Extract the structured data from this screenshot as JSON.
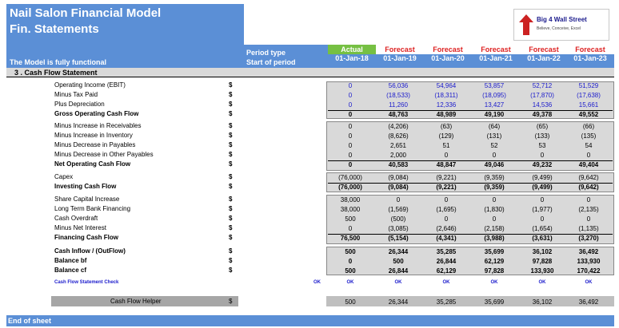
{
  "header": {
    "title": "Nail Salon Financial Model",
    "subtitle": "Fin. Statements",
    "note": "The Model is fully functional",
    "period_type_label": "Period type",
    "start_of_period_label": "Start of period",
    "logo": {
      "name": "Big 4 Wall Street",
      "tagline": "Believe, Conceive, Excel"
    }
  },
  "columns": [
    {
      "type": "Actual",
      "date": "01-Jan-18"
    },
    {
      "type": "Forecast",
      "date": "01-Jan-19"
    },
    {
      "type": "Forecast",
      "date": "01-Jan-20"
    },
    {
      "type": "Forecast",
      "date": "01-Jan-21"
    },
    {
      "type": "Forecast",
      "date": "01-Jan-22"
    },
    {
      "type": "Forecast",
      "date": "01-Jan-23"
    }
  ],
  "section_title": "3 .  Cash Flow Statement",
  "currency": "$",
  "rows": [
    {
      "label": "Operating Income (EBIT)",
      "values": [
        "0",
        "56,036",
        "54,964",
        "53,857",
        "52,712",
        "51,529"
      ]
    },
    {
      "label": "Minus Tax Paid",
      "values": [
        "0",
        "(18,533)",
        "(18,311)",
        "(18,095)",
        "(17,870)",
        "(17,638)"
      ]
    },
    {
      "label": "Plus Depreciation",
      "values": [
        "0",
        "11,260",
        "12,336",
        "13,427",
        "14,536",
        "15,661"
      ]
    },
    {
      "label": "Gross Operating Cash Flow",
      "values": [
        "0",
        "48,763",
        "48,989",
        "49,190",
        "49,378",
        "49,552"
      ]
    },
    {
      "label": "Minus Increase in Receivables",
      "values": [
        "0",
        "(4,206)",
        "(63)",
        "(64)",
        "(65)",
        "(66)"
      ]
    },
    {
      "label": "Minus Increase in Inventory",
      "values": [
        "0",
        "(8,626)",
        "(129)",
        "(131)",
        "(133)",
        "(135)"
      ]
    },
    {
      "label": "Minus Decrease in Payables",
      "values": [
        "0",
        "2,651",
        "51",
        "52",
        "53",
        "54"
      ]
    },
    {
      "label": "Minus Decrease in Other Payables",
      "values": [
        "0",
        "2,000",
        "0",
        "0",
        "0",
        "0"
      ]
    },
    {
      "label": "Net Operating Cash Flow",
      "values": [
        "0",
        "40,583",
        "48,847",
        "49,046",
        "49,232",
        "49,404"
      ]
    },
    {
      "label": "Capex",
      "values": [
        "(76,000)",
        "(9,084)",
        "(9,221)",
        "(9,359)",
        "(9,499)",
        "(9,642)"
      ]
    },
    {
      "label": "Investing Cash Flow",
      "values": [
        "(76,000)",
        "(9,084)",
        "(9,221)",
        "(9,359)",
        "(9,499)",
        "(9,642)"
      ]
    },
    {
      "label": "Share Capital Increase",
      "values": [
        "38,000",
        "0",
        "0",
        "0",
        "0",
        "0"
      ]
    },
    {
      "label": "Long Term Bank Financing",
      "values": [
        "38,000",
        "(1,569)",
        "(1,695)",
        "(1,830)",
        "(1,977)",
        "(2,135)"
      ]
    },
    {
      "label": "Cash Overdraft",
      "values": [
        "500",
        "(500)",
        "0",
        "0",
        "0",
        "0"
      ]
    },
    {
      "label": "Minus Net Interest",
      "values": [
        "0",
        "(3,085)",
        "(2,646)",
        "(2,158)",
        "(1,654)",
        "(1,135)"
      ]
    },
    {
      "label": "Financing Cash Flow",
      "values": [
        "76,500",
        "(5,154)",
        "(4,341)",
        "(3,988)",
        "(3,631)",
        "(3,270)"
      ]
    },
    {
      "label": "Cash Inflow / (OutFlow)",
      "values": [
        "500",
        "26,344",
        "35,285",
        "35,699",
        "36,102",
        "36,492"
      ]
    },
    {
      "label": "Balance bf",
      "values": [
        "0",
        "500",
        "26,844",
        "62,129",
        "97,828",
        "133,930"
      ]
    },
    {
      "label": "Balance cf",
      "values": [
        "500",
        "26,844",
        "62,129",
        "97,828",
        "133,930",
        "170,422"
      ]
    }
  ],
  "check": {
    "label": "Cash Flow Statement Check",
    "overall": "OK",
    "values": [
      "OK",
      "OK",
      "OK",
      "OK",
      "OK",
      "OK"
    ]
  },
  "helper": {
    "label": "Cash Flow Helper",
    "currency": "$",
    "values": [
      "500",
      "26,344",
      "35,285",
      "35,699",
      "36,102",
      "36,492"
    ]
  },
  "footer": "End of sheet",
  "colors": {
    "header_blue": "#5b8fd6",
    "actual_green": "#76c043",
    "forecast_red": "#dd2222",
    "input_blue": "#1a1acc"
  }
}
